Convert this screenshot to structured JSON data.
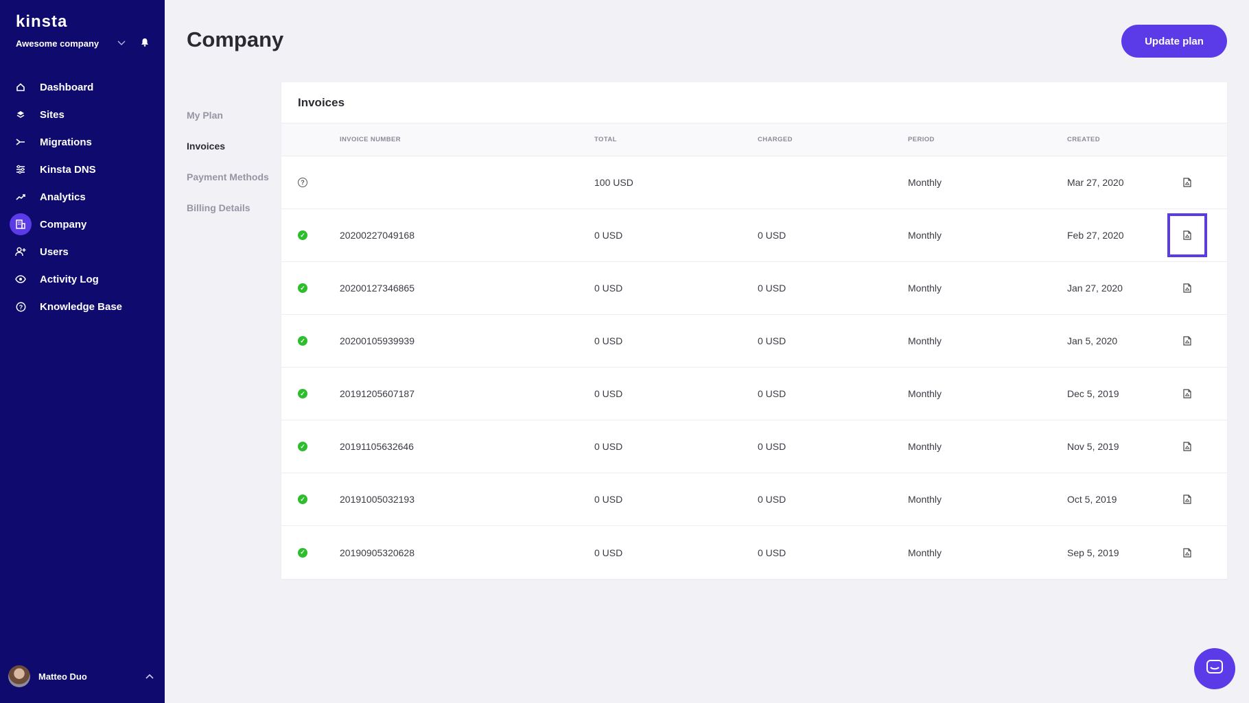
{
  "sidebar": {
    "logo": "kinsta",
    "company_name": "Awesome company",
    "items": [
      {
        "label": "Dashboard",
        "icon": "home-icon"
      },
      {
        "label": "Sites",
        "icon": "layers-icon"
      },
      {
        "label": "Migrations",
        "icon": "migrate-icon"
      },
      {
        "label": "Kinsta DNS",
        "icon": "dns-icon"
      },
      {
        "label": "Analytics",
        "icon": "trend-icon"
      },
      {
        "label": "Company",
        "icon": "building-icon",
        "active": true
      },
      {
        "label": "Users",
        "icon": "user-plus-icon"
      },
      {
        "label": "Activity Log",
        "icon": "eye-icon"
      },
      {
        "label": "Knowledge Base",
        "icon": "help-icon"
      }
    ],
    "user_name": "Matteo Duo"
  },
  "header": {
    "title": "Company",
    "update_button": "Update plan"
  },
  "subnav": {
    "items": [
      "My Plan",
      "Invoices",
      "Payment Methods",
      "Billing Details"
    ],
    "active": "Invoices"
  },
  "invoices": {
    "title": "Invoices",
    "columns": [
      "INVOICE NUMBER",
      "TOTAL",
      "CHARGED",
      "PERIOD",
      "CREATED"
    ],
    "rows": [
      {
        "status": "pending",
        "number": "",
        "total": "100 USD",
        "charged": "",
        "period": "Monthly",
        "created": "Mar 27, 2020"
      },
      {
        "status": "paid",
        "number": "20200227049168",
        "total": "0 USD",
        "charged": "0 USD",
        "period": "Monthly",
        "created": "Feb 27, 2020",
        "highlight": true
      },
      {
        "status": "paid",
        "number": "20200127346865",
        "total": "0 USD",
        "charged": "0 USD",
        "period": "Monthly",
        "created": "Jan 27, 2020"
      },
      {
        "status": "paid",
        "number": "20200105939939",
        "total": "0 USD",
        "charged": "0 USD",
        "period": "Monthly",
        "created": "Jan 5, 2020"
      },
      {
        "status": "paid",
        "number": "20191205607187",
        "total": "0 USD",
        "charged": "0 USD",
        "period": "Monthly",
        "created": "Dec 5, 2019"
      },
      {
        "status": "paid",
        "number": "20191105632646",
        "total": "0 USD",
        "charged": "0 USD",
        "period": "Monthly",
        "created": "Nov 5, 2019"
      },
      {
        "status": "paid",
        "number": "20191005032193",
        "total": "0 USD",
        "charged": "0 USD",
        "period": "Monthly",
        "created": "Oct 5, 2019"
      },
      {
        "status": "paid",
        "number": "20190905320628",
        "total": "0 USD",
        "charged": "0 USD",
        "period": "Monthly",
        "created": "Sep 5, 2019"
      }
    ]
  },
  "colors": {
    "sidebar_bg": "#0e0a6e",
    "accent": "#5b3be8",
    "success": "#2dbd2d"
  }
}
